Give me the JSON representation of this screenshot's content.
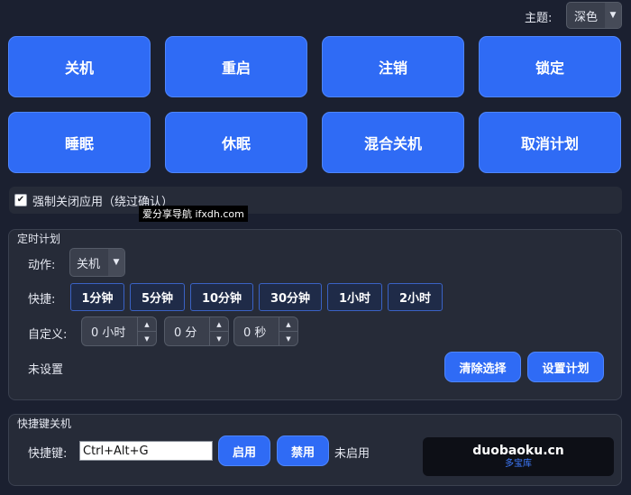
{
  "theme": {
    "label": "主题:",
    "value": "深色"
  },
  "main_buttons": [
    {
      "label": "关机"
    },
    {
      "label": "重启"
    },
    {
      "label": "注销"
    },
    {
      "label": "锁定"
    },
    {
      "label": "睡眠"
    },
    {
      "label": "休眠"
    },
    {
      "label": "混合关机"
    },
    {
      "label": "取消计划"
    }
  ],
  "force_close": {
    "label": "强制关闭应用（绕过确认）",
    "checked": true
  },
  "watermark_tip": "爱分享导航 ifxdh.com",
  "schedule": {
    "title": "定时计划",
    "action_label": "动作:",
    "action_value": "关机",
    "quick_label": "快捷:",
    "quick_options": [
      "1分钟",
      "5分钟",
      "10分钟",
      "30分钟",
      "1小时",
      "2小时"
    ],
    "custom_label": "自定义:",
    "hours": "0 小时",
    "minutes": "0 分",
    "seconds": "0 秒",
    "status": "未设置",
    "clear_button": "清除选择",
    "set_button": "设置计划"
  },
  "hotkey": {
    "title": "快捷键关机",
    "label": "快捷键:",
    "value": "Ctrl+Alt+G",
    "enable_button": "启用",
    "disable_button": "禁用",
    "status": "未启用"
  },
  "brand": {
    "name": "duobaoku.cn",
    "sub": "多宝库"
  }
}
